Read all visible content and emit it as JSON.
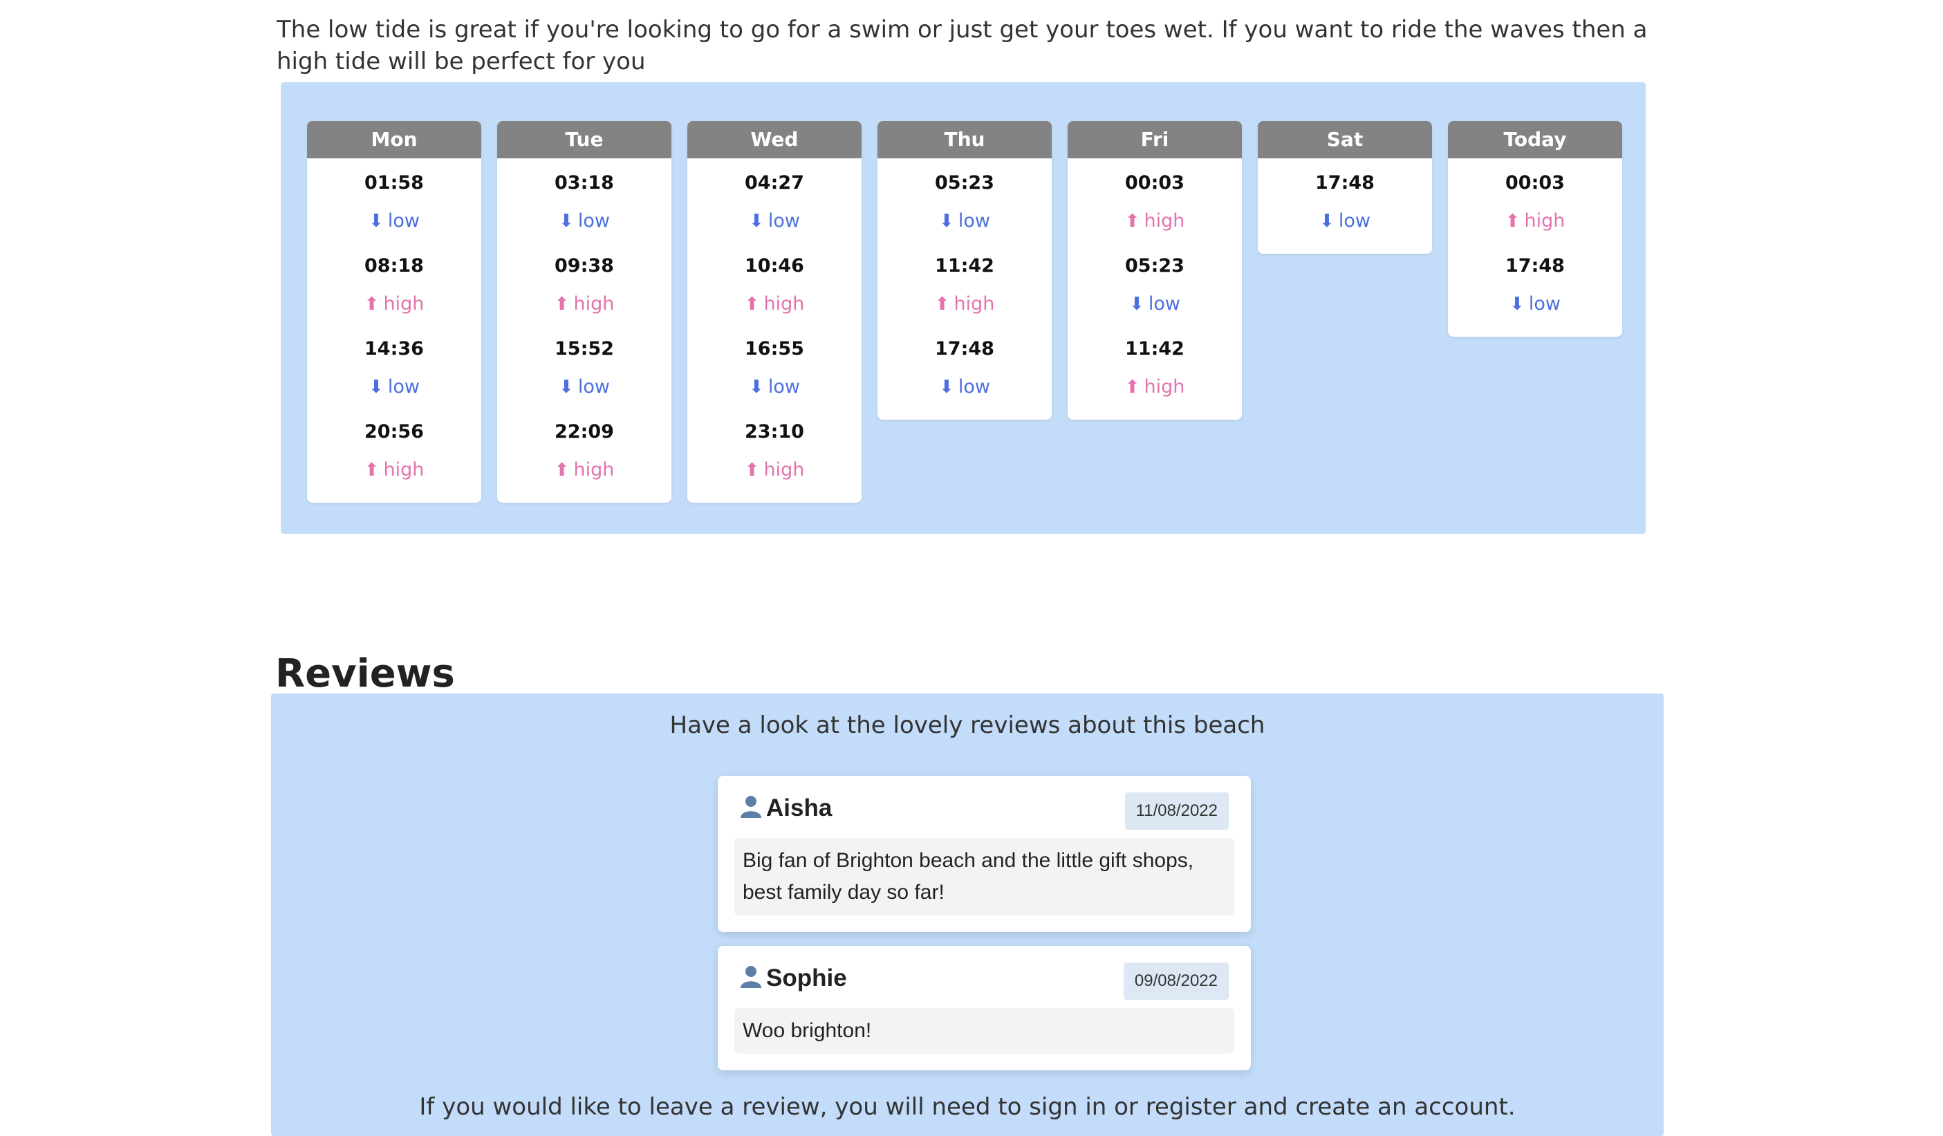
{
  "intro_text": "The low tide is great if you're looking to go for a swim or just get your toes wet. If you want to ride the waves then a high tide will be perfect for you",
  "tides": {
    "days": [
      {
        "day": "Mon",
        "entries": [
          {
            "time": "01:58",
            "type": "low"
          },
          {
            "time": "08:18",
            "type": "high"
          },
          {
            "time": "14:36",
            "type": "low"
          },
          {
            "time": "20:56",
            "type": "high"
          }
        ]
      },
      {
        "day": "Tue",
        "entries": [
          {
            "time": "03:18",
            "type": "low"
          },
          {
            "time": "09:38",
            "type": "high"
          },
          {
            "time": "15:52",
            "type": "low"
          },
          {
            "time": "22:09",
            "type": "high"
          }
        ]
      },
      {
        "day": "Wed",
        "entries": [
          {
            "time": "04:27",
            "type": "low"
          },
          {
            "time": "10:46",
            "type": "high"
          },
          {
            "time": "16:55",
            "type": "low"
          },
          {
            "time": "23:10",
            "type": "high"
          }
        ]
      },
      {
        "day": "Thu",
        "entries": [
          {
            "time": "05:23",
            "type": "low"
          },
          {
            "time": "11:42",
            "type": "high"
          },
          {
            "time": "17:48",
            "type": "low"
          }
        ]
      },
      {
        "day": "Fri",
        "entries": [
          {
            "time": "00:03",
            "type": "high"
          },
          {
            "time": "05:23",
            "type": "low"
          },
          {
            "time": "11:42",
            "type": "high"
          }
        ]
      },
      {
        "day": "Sat",
        "entries": [
          {
            "time": "17:48",
            "type": "low"
          }
        ]
      },
      {
        "day": "Today",
        "entries": [
          {
            "time": "00:03",
            "type": "high"
          },
          {
            "time": "17:48",
            "type": "low"
          }
        ]
      }
    ],
    "icons": {
      "low": "arrow-down-icon",
      "high": "arrow-up-icon"
    },
    "colors": {
      "low": "#4c6fe0",
      "high": "#e273ad",
      "header": "#838383",
      "panel": "#c2dcf9"
    }
  },
  "reviews": {
    "title": "Reviews",
    "intro": "Have a look at the lovely reviews about this beach",
    "items": [
      {
        "user": "Aisha",
        "date": "11/08/2022",
        "text": "Big fan of Brighton beach and the little gift shops, best family day so far!"
      },
      {
        "user": "Sophie",
        "date": "09/08/2022",
        "text": "Woo brighton!"
      }
    ],
    "outro": "If you would like to leave a review, you will need to sign in or register and create an account.",
    "user_icon": "user-icon"
  }
}
